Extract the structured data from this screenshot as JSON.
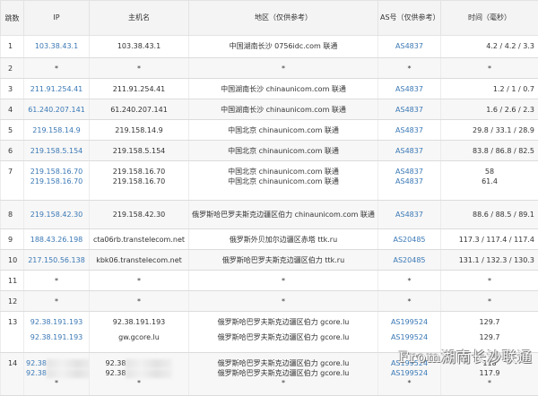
{
  "headers": {
    "hop": "跳数",
    "ip": "IP",
    "hostname": "主机名",
    "region": "地区（仅供参考）",
    "as": "AS号（仅供参考）",
    "time": "时间（毫秒）"
  },
  "rows": [
    {
      "hop": "1",
      "ip": "103.38.43.1",
      "host": "103.38.43.1",
      "geo": "中国湖南长沙 0756idc.com 联通",
      "as": "AS4837",
      "time": "4.2 / 4.2 / 3.3"
    },
    {
      "hop": "2",
      "ip": "*",
      "host": "*",
      "geo": "*",
      "as": "*",
      "time": "*"
    },
    {
      "hop": "3",
      "ip": "211.91.254.41",
      "host": "211.91.254.41",
      "geo": "中国湖南长沙 chinaunicom.com 联通",
      "as": "AS4837",
      "time": "1.2 / 1 / 0.7"
    },
    {
      "hop": "4",
      "ip": "61.240.207.141",
      "host": "61.240.207.141",
      "geo": "中国湖南长沙 chinaunicom.com 联通",
      "as": "AS4837",
      "time": "1.6 / 2.6 / 2.3"
    },
    {
      "hop": "5",
      "ip": "219.158.14.9",
      "host": "219.158.14.9",
      "geo": "中国北京 chinaunicom.com 联通",
      "as": "AS4837",
      "time": "29.8 / 33.1 / 28.9"
    },
    {
      "hop": "6",
      "ip": "219.158.5.154",
      "host": "219.158.5.154",
      "geo": "中国北京 chinaunicom.com 联通",
      "as": "AS4837",
      "time": "83.8 / 86.8 / 82.5"
    },
    {
      "hop": "7",
      "ip1": "219.158.16.70",
      "ip2": "219.158.16.70",
      "host1": "219.158.16.70",
      "host2": "219.158.16.70",
      "geo1": "中国北京 chinaunicom.com 联通",
      "geo2": "中国北京 chinaunicom.com 联通",
      "as1": "AS4837",
      "as2": "AS4837",
      "time1": "58",
      "time2": "61.4"
    },
    {
      "hop": "8",
      "ip": "219.158.42.30",
      "host": "219.158.42.30",
      "geo": "俄罗斯哈巴罗夫斯克边疆区伯力 chinaunicom.com 联通",
      "as": "AS4837",
      "time": "88.6 / 88.5 / 89.1"
    },
    {
      "hop": "9",
      "ip": "188.43.26.198",
      "host": "cta06rb.transtelecom.net",
      "geo": "俄罗斯外贝加尔边疆区赤塔 ttk.ru",
      "as": "AS20485",
      "time": "117.3 / 117.4 / 117.4"
    },
    {
      "hop": "10",
      "ip": "217.150.56.138",
      "host": "kbk06.transtelecom.net",
      "geo": "俄罗斯哈巴罗夫斯克边疆区伯力 ttk.ru",
      "as": "AS20485",
      "time": "131.1 / 132.3 / 130.3"
    },
    {
      "hop": "11",
      "ip": "*",
      "host": "*",
      "geo": "*",
      "as": "*",
      "time": "*"
    },
    {
      "hop": "12",
      "ip": "*",
      "host": "*",
      "geo": "*",
      "as": "*",
      "time": "*"
    },
    {
      "hop": "13",
      "ip1": "92.38.191.193",
      "ip2": "92.38.191.193",
      "host1": "92.38.191.193",
      "host2": "gw.gcore.lu",
      "geo1": "俄罗斯哈巴罗夫斯克边疆区伯力 gcore.lu",
      "geo2": "俄罗斯哈巴罗夫斯克边疆区伯力 gcore.lu",
      "as1": "AS199524",
      "as2": "AS199524",
      "time1": "129.7",
      "time2": "129.7"
    },
    {
      "hop": "14",
      "ip1": "92.38",
      "ip2": "92.38",
      "host1": "92.38",
      "host2": "92.38",
      "geo1": "俄罗斯哈巴罗夫斯克边疆区伯力 gcore.lu",
      "geo2": "俄罗斯哈巴罗夫斯克边疆区伯力 gcore.lu",
      "as1": "AS199524",
      "as2": "AS199524",
      "time1": "118",
      "time2": "117.9",
      "star": "*"
    }
  ],
  "watermark": "From湖南长沙联通"
}
